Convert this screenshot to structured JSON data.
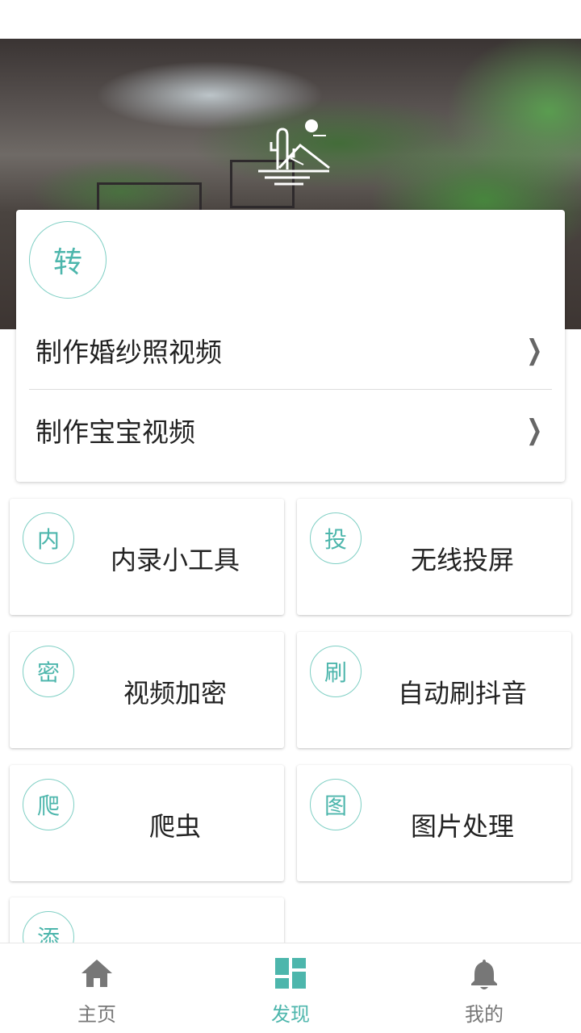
{
  "banner": {
    "icon": "landscape-cactus-logo"
  },
  "top_card": {
    "badge": "转",
    "items": [
      {
        "label": "制作婚纱照视频",
        "icon": "chevron-right-icon"
      },
      {
        "label": "制作宝宝视频",
        "icon": "chevron-right-icon"
      }
    ]
  },
  "grid": [
    {
      "badge": "内",
      "title": "内录小工具"
    },
    {
      "badge": "投",
      "title": "无线投屏"
    },
    {
      "badge": "密",
      "title": "视频加密"
    },
    {
      "badge": "刷",
      "title": "自动刷抖音"
    },
    {
      "badge": "爬",
      "title": "爬虫"
    },
    {
      "badge": "图",
      "title": "图片处理"
    },
    {
      "badge": "添",
      "title": ""
    }
  ],
  "bottom_nav": [
    {
      "label": "主页",
      "icon": "home-icon"
    },
    {
      "label": "发现",
      "icon": "dashboard-icon",
      "active": true
    },
    {
      "label": "我的",
      "icon": "bell-icon"
    }
  ],
  "colors": {
    "accent": "#4db6ac",
    "inactive": "#777777"
  }
}
